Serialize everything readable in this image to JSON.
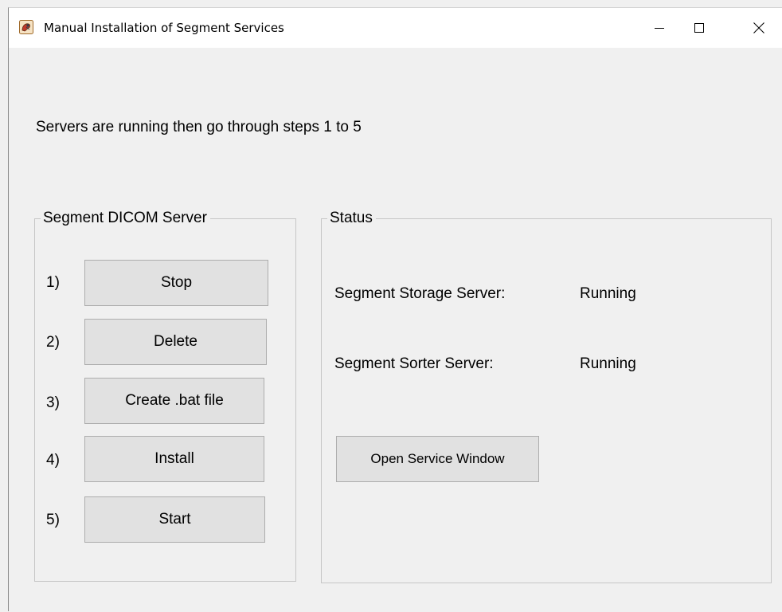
{
  "window": {
    "title": "Manual Installation of Segment Services"
  },
  "instruction": "Servers are running then go through steps 1 to 5",
  "dicom_group": {
    "title": "Segment DICOM Server",
    "steps": [
      {
        "number": "1)",
        "label": "Stop"
      },
      {
        "number": "2)",
        "label": "Delete"
      },
      {
        "number": "3)",
        "label": "Create .bat file"
      },
      {
        "number": "4)",
        "label": "Install"
      },
      {
        "number": "5)",
        "label": "Start"
      }
    ]
  },
  "status_group": {
    "title": "Status",
    "storage_label": "Segment Storage Server:",
    "storage_value": "Running",
    "sorter_label": "Segment Sorter Server:",
    "sorter_value": "Running",
    "open_service_label": "Open Service Window"
  },
  "icons": {
    "app": "segment-app-icon",
    "minimize": "minimize-icon",
    "maximize": "maximize-icon",
    "close": "close-icon"
  }
}
